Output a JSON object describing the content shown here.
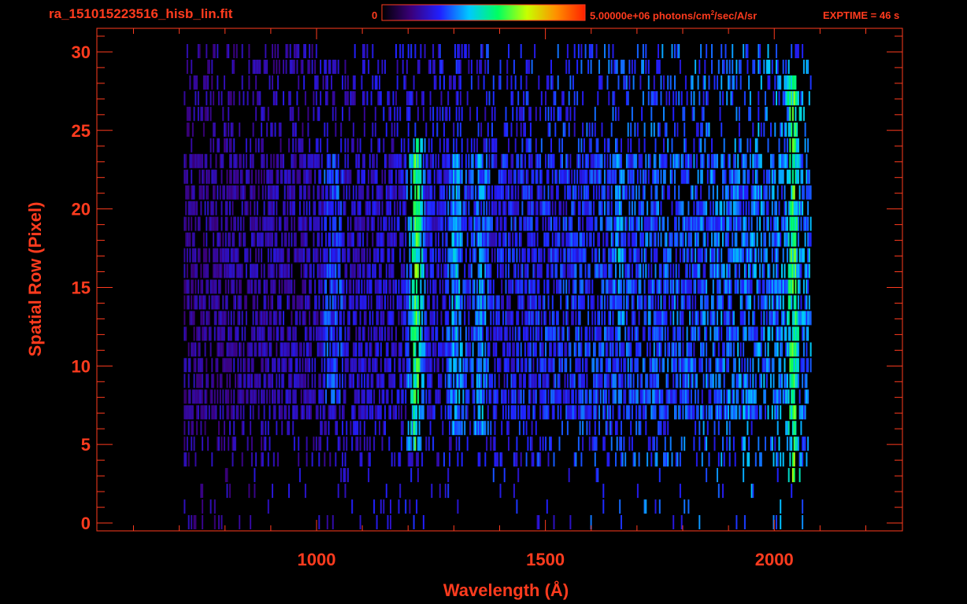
{
  "header": {
    "filename": "ra_151015223516_hisb_lin.fit",
    "colorbar_min": "0",
    "colorbar_max_value": "5.00000e+06 photons/cm",
    "colorbar_max_exp": "2",
    "colorbar_max_unit": "/sec/A/sr",
    "exptime": "EXPTIME = 46 s"
  },
  "colors": {
    "background": "#000000",
    "axes": "#ff3b1e",
    "colormap": [
      "#000000",
      "#3a007a",
      "#2020ff",
      "#00c8ff",
      "#00ff60",
      "#c8ff00",
      "#ff9000",
      "#ff2000"
    ]
  },
  "chart_data": {
    "type": "heatmap",
    "xlabel": "Wavelength (Å)",
    "ylabel": "Spatial Row (Pixel)",
    "xlim": [
      520,
      2280
    ],
    "ylim": [
      -0.5,
      31.5
    ],
    "xticks": [
      1000,
      1500,
      2000
    ],
    "xtick_labels": [
      "1000",
      "1500",
      "2000"
    ],
    "yticks": [
      0,
      5,
      10,
      15,
      20,
      25,
      30
    ],
    "ytick_labels": [
      "0",
      "5",
      "10",
      "15",
      "20",
      "25",
      "30"
    ],
    "colorbar_range": [
      0,
      5000000
    ],
    "data_x_range": [
      710,
      2080
    ],
    "data_row_range": [
      0,
      30
    ],
    "bright_rows": [
      7,
      23
    ],
    "emission_features": [
      {
        "wavelength": 1216,
        "rows": [
          5,
          24
        ],
        "level": 0.6
      },
      {
        "wavelength": 1304,
        "rows": [
          6,
          23
        ],
        "level": 0.42
      },
      {
        "wavelength": 1356,
        "rows": [
          6,
          23
        ],
        "level": 0.4
      },
      {
        "wavelength": 1035,
        "rows": [
          8,
          23
        ],
        "level": 0.32
      },
      {
        "wavelength": 1660,
        "rows": [
          12,
          23
        ],
        "level": 0.42
      },
      {
        "wavelength": 2040,
        "rows": [
          3,
          28
        ],
        "level": 0.62
      }
    ]
  }
}
